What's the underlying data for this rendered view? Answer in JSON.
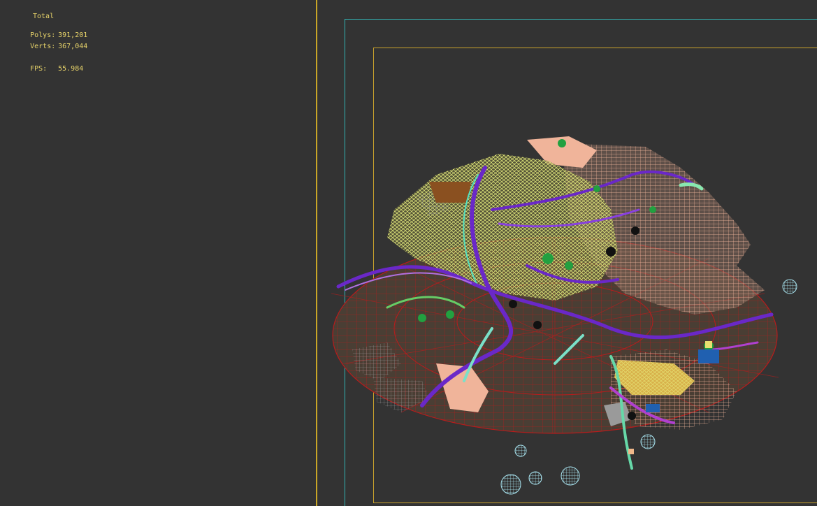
{
  "hud": {
    "header_total": "Total",
    "polys_label": "Polys:",
    "polys_value": "391,201",
    "verts_label": "Verts:",
    "verts_value": "367,044",
    "fps_label": "FPS:",
    "fps_value": "55.984",
    "cut_text": "......  ...."
  },
  "colors": {
    "background": "#333333",
    "hud_text": "#e8d46a",
    "viewport_border": "#c9a627",
    "safe_frame_outer": "#33b4b4",
    "safe_frame_inner": "#c9a22c",
    "terrain_wire": "#b81c1c",
    "grass_wire": "#e8f080",
    "river": "#6a28c8"
  }
}
